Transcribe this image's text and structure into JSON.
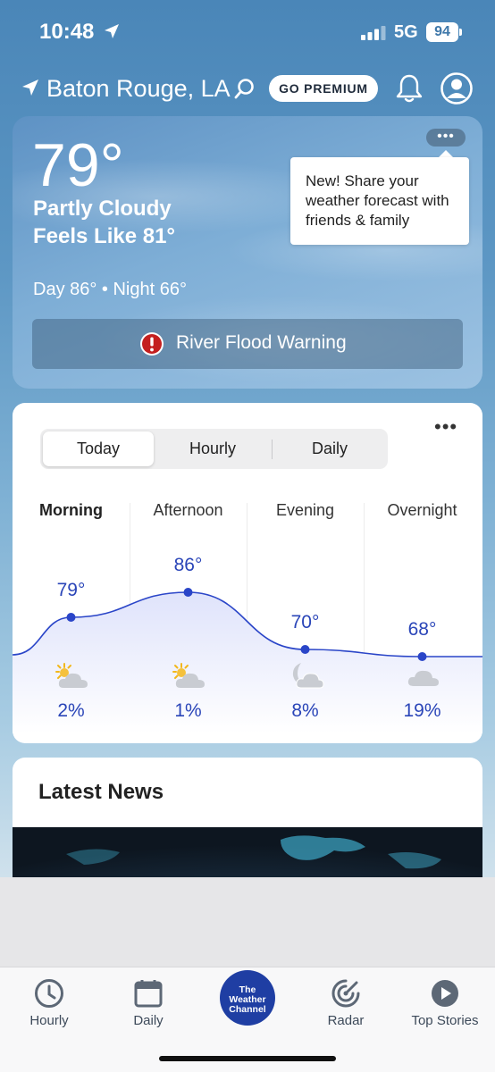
{
  "status_bar": {
    "time": "10:48",
    "network": "5G",
    "battery": "94"
  },
  "header": {
    "location": "Baton Rouge, LA",
    "premium_label": "GO PREMIUM"
  },
  "current": {
    "temperature": "79°",
    "condition": "Partly Cloudy",
    "feels_like": "Feels Like 81°",
    "day_night": "Day 86° • Night 66°",
    "more": "•••",
    "tooltip": "New! Share your weather forecast with friends & family",
    "alert": "River Flood Warning"
  },
  "forecast": {
    "more": "•••",
    "tabs": [
      {
        "label": "Today",
        "active": true
      },
      {
        "label": "Hourly",
        "active": false
      },
      {
        "label": "Daily",
        "active": false
      }
    ],
    "periods": [
      {
        "name": "Morning",
        "temp": "79°",
        "temp_value": 79,
        "icon": "partly-sunny-icon",
        "precip": "2%"
      },
      {
        "name": "Afternoon",
        "temp": "86°",
        "temp_value": 86,
        "icon": "partly-sunny-icon",
        "precip": "1%"
      },
      {
        "name": "Evening",
        "temp": "70°",
        "temp_value": 70,
        "icon": "partly-cloudy-night-icon",
        "precip": "8%"
      },
      {
        "name": "Overnight",
        "temp": "68°",
        "temp_value": 68,
        "icon": "cloudy-icon",
        "precip": "19%"
      }
    ],
    "line_color": "#2a45c8"
  },
  "news": {
    "title": "Latest News"
  },
  "tab_bar": {
    "tabs": [
      {
        "label": "Hourly",
        "icon": "clock-icon"
      },
      {
        "label": "Daily",
        "icon": "calendar-icon"
      },
      {
        "label": "The Weather Channel",
        "icon": "twc-logo"
      },
      {
        "label": "Radar",
        "icon": "radar-icon"
      },
      {
        "label": "Top Stories",
        "icon": "play-icon"
      }
    ],
    "logo_text": "The Weather Channel"
  }
}
